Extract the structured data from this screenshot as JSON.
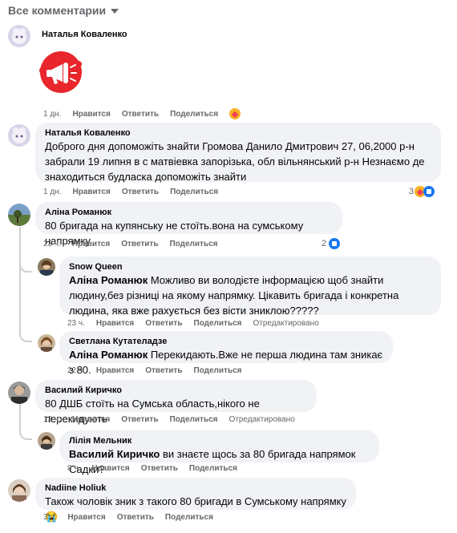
{
  "header": {
    "sort_label": "Все комментарии"
  },
  "comments": [
    {
      "author": "Наталья Коваленко",
      "time": "1 дн.",
      "like_label": "Нравится",
      "reply_label": "Ответить",
      "share_label": "Поделиться",
      "reaction_icon": "care-emoji",
      "sticker": "megaphone-sticker"
    },
    {
      "author": "Наталья Коваленко",
      "text": "Доброго дня допоможіть знайти Громова Данило Дмитрович 27, 06,2000 р-н забрали 19 липня в с матвіевка запорізька, обл вільнянський р-н Незнаємо де знаходиться будласка допоможіть знайти",
      "time": "1 дн.",
      "like_label": "Нравится",
      "reply_label": "Ответить",
      "share_label": "Поделиться",
      "reaction_count": "3"
    },
    {
      "author": "Аліна Романюк",
      "text": "80 бригада на купянську не стоїть.вона на сумському напрямку",
      "time": "23 ч.",
      "like_label": "Нравится",
      "reply_label": "Ответить",
      "share_label": "Поделиться",
      "reaction_count": "2",
      "replies": [
        {
          "author": "Snow Queen",
          "mention": "Аліна Романюк",
          "text": " Можливо ви володієте інформацією щоб знайти людину,без різниці на якому напрямку. Цікавить бригада і конкретна людина, яка вже рахується без вісти зниклою?????",
          "time": "23 ч.",
          "like_label": "Нравится",
          "reply_label": "Ответить",
          "share_label": "Поделиться",
          "edited_label": "Отредактировано"
        },
        {
          "author": "Светлана Кутателадзе",
          "mention": "Аліна Романюк",
          "text": " Перекидають.Вже не перша людина там зникає з 80.",
          "time": "22 ч.",
          "like_label": "Нравится",
          "reply_label": "Ответить",
          "share_label": "Поделиться"
        }
      ]
    },
    {
      "author": "Василий Киричко",
      "text": "80 ДШБ стоїть на Сумська область,нікого не перекидують",
      "time": "12 ч.",
      "like_label": "Нравится",
      "reply_label": "Ответить",
      "share_label": "Поделиться",
      "edited_label": "Отредактировано",
      "replies": [
        {
          "author": "Лілія Мельник",
          "mention": "Василий Киричко",
          "text": " ви знаєте щось за 80 бригада напрямок Садки?",
          "time": "8 ч.",
          "like_label": "Нравится",
          "reply_label": "Ответить",
          "share_label": "Поделиться"
        }
      ]
    },
    {
      "author": "Nadiine Holiuk",
      "text": "Також чоловік зник з такого 80 бригади в Сумському напрямку 😭",
      "time": "3 ч.",
      "like_label": "Нравится",
      "reply_label": "Ответить",
      "share_label": "Поделиться"
    }
  ],
  "colors": {
    "bubble": "#f0f2f5",
    "meta": "#65676b",
    "like_blue": "#1877f2",
    "sticker_red": "#e8262b"
  }
}
